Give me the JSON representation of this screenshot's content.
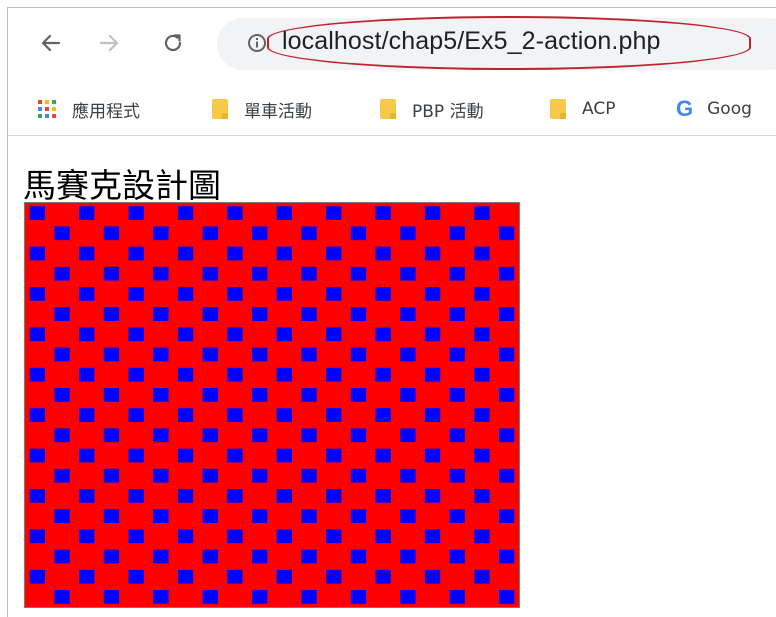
{
  "browser": {
    "url": "localhost/chap5/Ex5_2-action.php"
  },
  "bookmarks": [
    {
      "label": "應用程式",
      "icon": "apps-grid-icon"
    },
    {
      "label": "單車活動",
      "icon": "folder-icon"
    },
    {
      "label": "PBP 活動",
      "icon": "folder-icon"
    },
    {
      "label": "ACP",
      "icon": "folder-icon"
    },
    {
      "label": "Goog",
      "icon": "google-icon"
    }
  ],
  "page": {
    "title": "馬賽克設計圖"
  },
  "mosaic": {
    "rows": 20,
    "cols": 20,
    "base_color": "#ff0000",
    "tile_color": "#0000ff"
  },
  "colors": {
    "url_highlight": "#c0212f",
    "omnibox_bg": "#f1f3f4"
  }
}
